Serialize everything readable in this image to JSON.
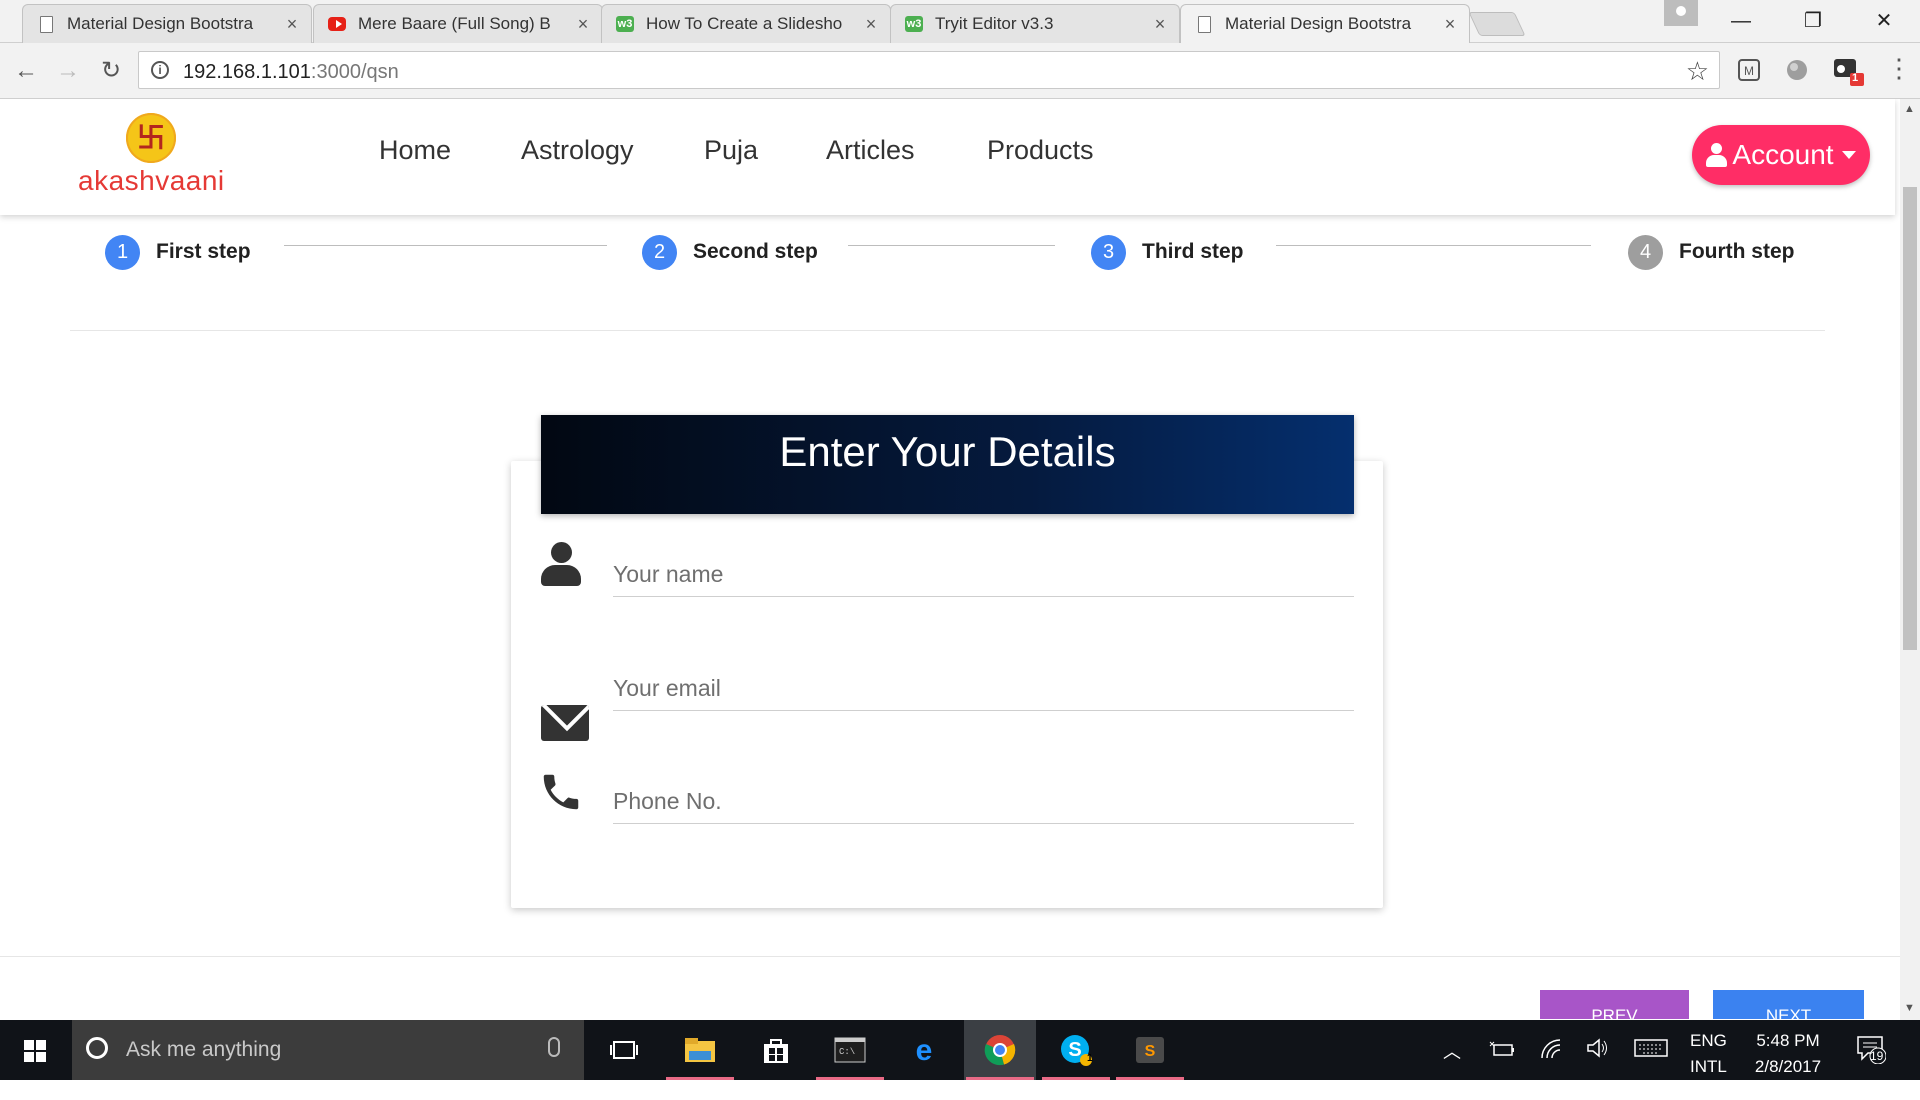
{
  "browser": {
    "tabs": [
      {
        "title": "Material Design Bootstra",
        "favicon": "document-icon"
      },
      {
        "title": "Mere Baare (Full Song) B",
        "favicon": "youtube-icon"
      },
      {
        "title": "How To Create a Slidesho",
        "favicon": "w3schools-icon"
      },
      {
        "title": "Tryit Editor v3.3",
        "favicon": "w3schools-icon"
      },
      {
        "title": "Material Design Bootstra",
        "favicon": "document-icon",
        "active": true
      }
    ],
    "close_glyph": "×",
    "url_host": "192.168.1.101",
    "url_rest": ":3000/qsn",
    "favicon_w3_text": "w3"
  },
  "site": {
    "logo_text": "akashvaani",
    "logo_symbol": "卐",
    "nav": [
      "Home",
      "Astrology",
      "Puja",
      "Articles",
      "Products"
    ],
    "account_label": "Account",
    "accent_color": "#ff2d66"
  },
  "stepper": {
    "steps": [
      {
        "num": "1",
        "label": "First step",
        "state": "done"
      },
      {
        "num": "2",
        "label": "Second step",
        "state": "done"
      },
      {
        "num": "3",
        "label": "Third step",
        "state": "current"
      },
      {
        "num": "4",
        "label": "Fourth step",
        "state": "pending"
      }
    ],
    "active_color": "#4285f4",
    "pending_color": "#9e9e9e"
  },
  "form": {
    "title": "Enter Your Details",
    "name_placeholder": "Your name",
    "email_placeholder": "Your email",
    "phone_placeholder": "Phone No.",
    "prev_label": "PREV",
    "next_label": "NEXT"
  },
  "taskbar": {
    "search_placeholder": "Ask me anything",
    "lang_top": "ENG",
    "lang_bottom": "INTL",
    "time": "5:48 PM",
    "date": "2/8/2017",
    "notification_count": "19",
    "skype_badge": "1",
    "ext_badge": "1"
  }
}
